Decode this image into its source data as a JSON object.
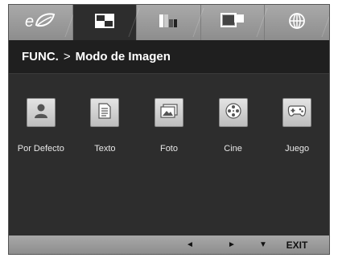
{
  "tabs": [
    {
      "icon": "eco-leaf-icon",
      "active": false
    },
    {
      "icon": "picture-icon",
      "active": true
    },
    {
      "icon": "color-icon",
      "active": false
    },
    {
      "icon": "picture-in-picture-icon",
      "active": false
    },
    {
      "icon": "globe-icon",
      "active": false
    }
  ],
  "header": {
    "section": "FUNC.",
    "separator": ">",
    "title": "Modo de Imagen"
  },
  "modes": [
    {
      "label": "Por Defecto",
      "icon": "person-icon"
    },
    {
      "label": "Texto",
      "icon": "document-icon"
    },
    {
      "label": "Foto",
      "icon": "photo-icon"
    },
    {
      "label": "Cine",
      "icon": "film-reel-icon"
    },
    {
      "label": "Juego",
      "icon": "gamepad-icon"
    }
  ],
  "footer": {
    "left": "◄",
    "right": "►",
    "down": "▼",
    "exit": "EXIT"
  },
  "colors": {
    "panel": "#2d2d2d",
    "header": "#1f1f1f",
    "bar": "#9a9a9a",
    "text": "#ffffff"
  }
}
